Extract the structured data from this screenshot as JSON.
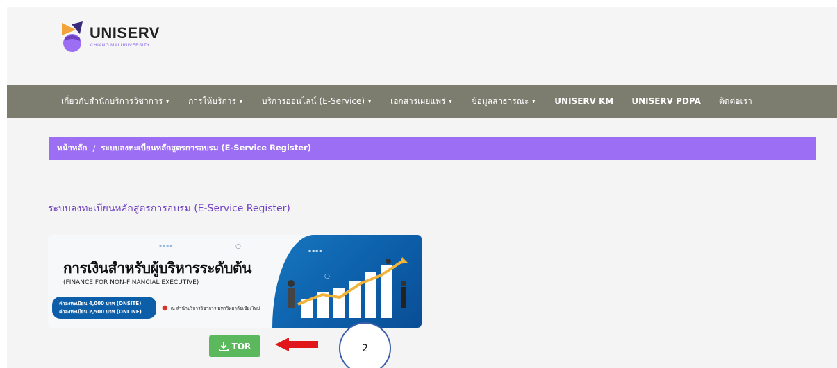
{
  "brand": {
    "name": "UNISERV",
    "subtitle": "CHIANG MAI UNIVERSITY"
  },
  "nav": {
    "items": [
      {
        "label": "เกี่ยวกับสำนักบริการวิชาการ",
        "dropdown": true
      },
      {
        "label": "การให้บริการ",
        "dropdown": true
      },
      {
        "label": "บริการออนไลน์ (E-Service)",
        "dropdown": true
      },
      {
        "label": "เอกสารเผยแพร่",
        "dropdown": true
      },
      {
        "label": "ข้อมูลสาธารณะ",
        "dropdown": true
      },
      {
        "label": "UNISERV KM",
        "dropdown": false
      },
      {
        "label": "UNISERV PDPA",
        "dropdown": false
      },
      {
        "label": "ติดต่อเรา",
        "dropdown": false
      }
    ],
    "caret": "▾"
  },
  "breadcrumb": {
    "home": "หน้าหลัก",
    "separator": "/",
    "current": "ระบบลงทะเบียนหลักสูตรการอบรม (E-Service Register)"
  },
  "page": {
    "title": "ระบบลงทะเบียนหลักสูตรการอบรม (E-Service Register)"
  },
  "banner": {
    "title": "การเงินสำหรับผู้บริหารระดับต้น",
    "subtitle": "(FINANCE FOR NON-FINANCIAL EXECUTIVE)",
    "fee_onsite": "ค่าลงทะเบียน 4,000 บาท (ONSITE)",
    "fee_online": "ค่าลงทะเบียน 2,500 บาท (ONLINE)",
    "venue": "ณ สำนักบริการวิชาการ มหาวิทยาลัยเชียงใหม่"
  },
  "actions": {
    "tor_label": "TOR"
  },
  "annotation": {
    "callout_number": "2"
  },
  "colors": {
    "navbar": "#7c7c6f",
    "breadcrumb": "#9b6ef3",
    "title": "#6f42c1",
    "tor_button": "#5cb85c",
    "arrow": "#e0161b",
    "callout_border": "#3a5fa8"
  },
  "icons": {
    "tor": "download-icon",
    "venue": "map-pin-icon",
    "arrow": "arrow-left-icon"
  }
}
